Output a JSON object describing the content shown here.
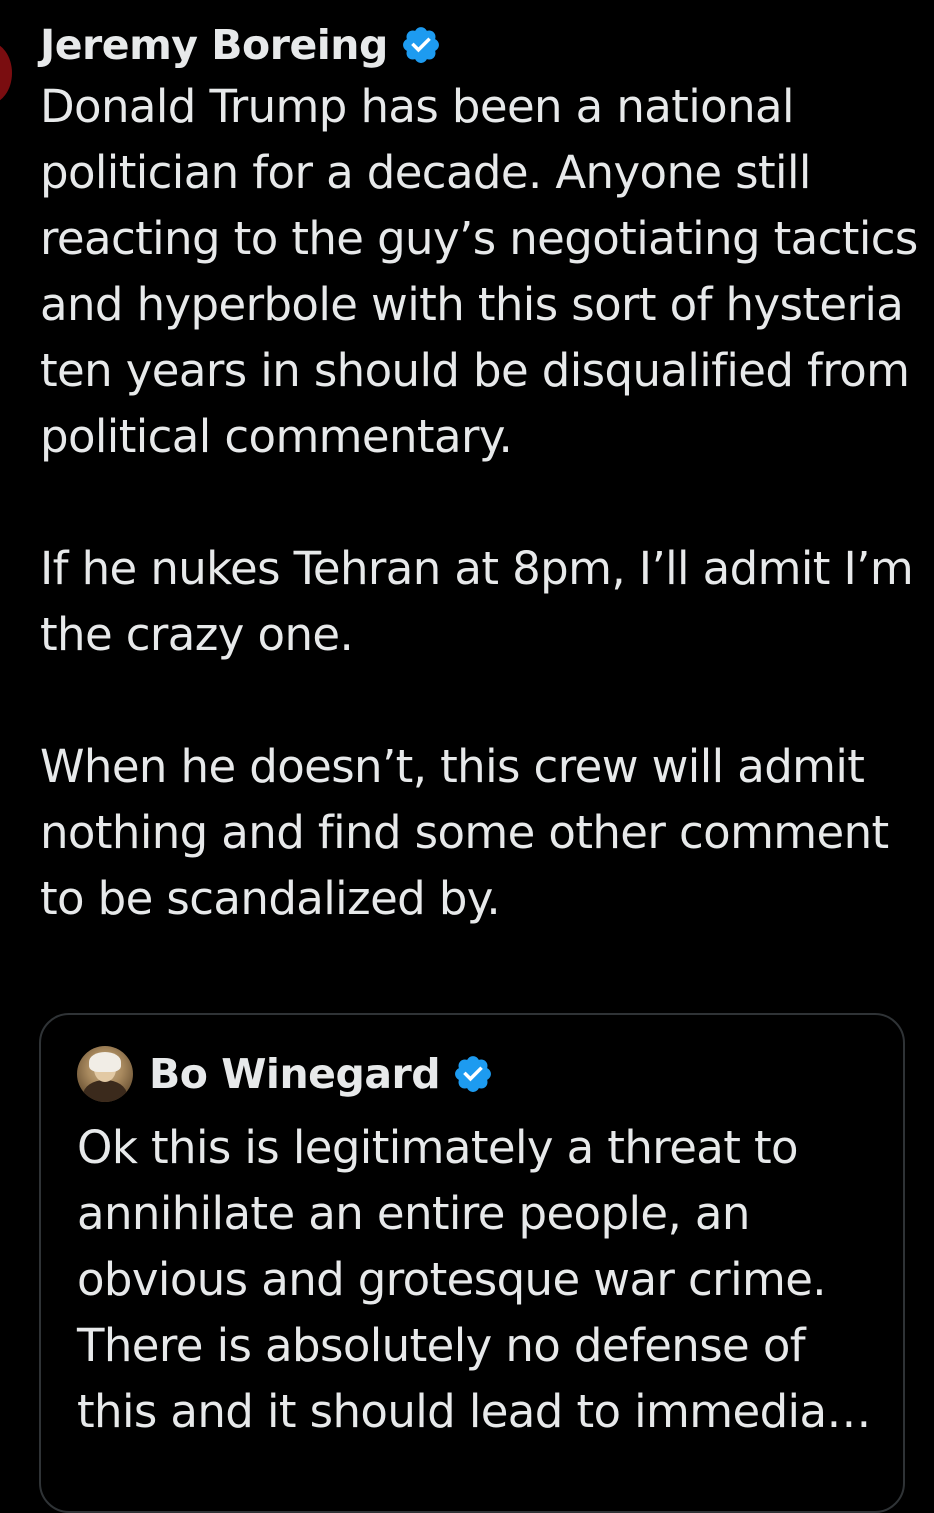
{
  "tweet": {
    "author_name": "Jeremy Boreing",
    "verified_icon": "verified-badge-icon",
    "paragraphs": [
      "Donald Trump has been a national politician for a decade. Anyone still reacting to the guy’s negotiating tactics and hyperbole with this sort of hysteria ten years in should be disqualified from political commentary.",
      "If he nukes Tehran at 8pm, I’ll admit I’m the crazy one.",
      "When he doesn’t, this crew will admit nothing and find some other comment to be scandalized by."
    ]
  },
  "quoted_tweet": {
    "author_name": "Bo Winegard",
    "verified_icon": "verified-badge-icon",
    "text": "Ok this is legitimately a threat to annihilate an entire people, an obvious and grotesque war crime. There is absolutely no defense of this and it should lead to immedia…"
  },
  "colors": {
    "background": "#000000",
    "text": "#e7e9ea",
    "verified_blue": "#1d9bf0",
    "border": "#2f3336"
  }
}
